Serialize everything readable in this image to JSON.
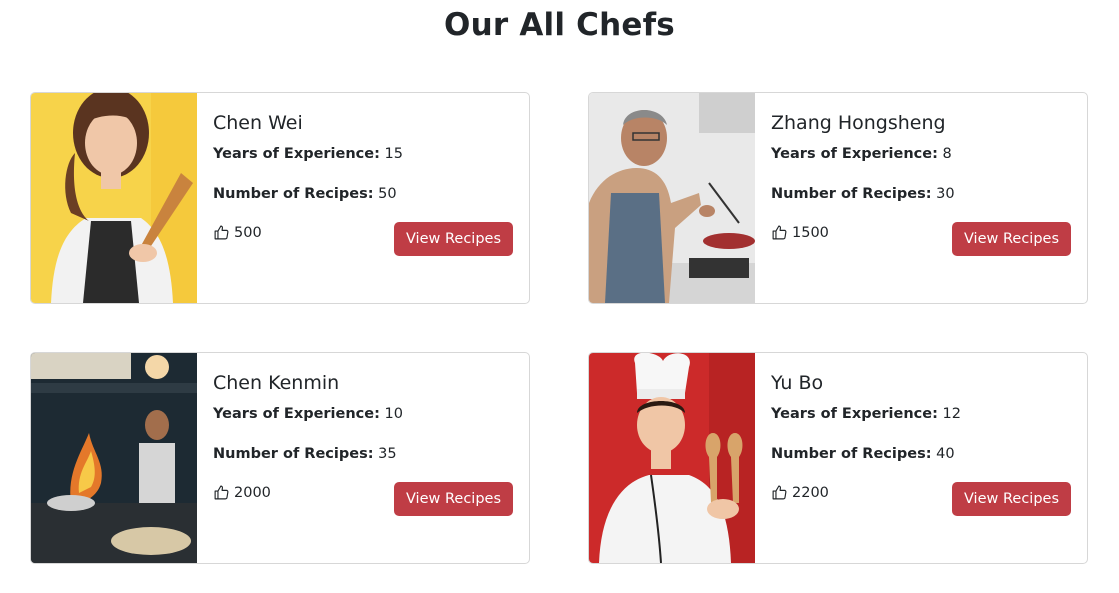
{
  "page": {
    "title": "Our All Chefs"
  },
  "labels": {
    "experience": "Years of Experience:",
    "recipes": "Number of Recipes:",
    "view_button": "View Recipes"
  },
  "icons": {
    "like": "thumbs-up-icon"
  },
  "colors": {
    "button": "#bf3d45"
  },
  "chefs": [
    {
      "name": "Chen Wei",
      "experience": "15",
      "recipes": "50",
      "likes": "500"
    },
    {
      "name": "Zhang Hongsheng",
      "experience": "8",
      "recipes": "30",
      "likes": "1500"
    },
    {
      "name": "Chen Kenmin",
      "experience": "10",
      "recipes": "35",
      "likes": "2000"
    },
    {
      "name": "Yu Bo",
      "experience": "12",
      "recipes": "40",
      "likes": "2200"
    }
  ]
}
